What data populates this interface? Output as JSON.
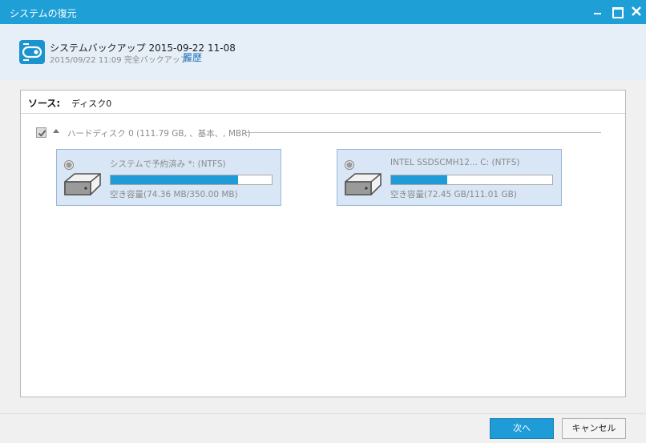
{
  "window": {
    "title": "システムの復元"
  },
  "header": {
    "backup_title": "システムバックアップ 2015-09-22 11-08",
    "backup_subtitle": "2015/09/22 11:09 完全バックアップ",
    "history_link": "履歴"
  },
  "source": {
    "label": "ソース:",
    "value": "ディスク0"
  },
  "disk": {
    "label": "ハードディスク 0 (111.79 GB, 、基本、, MBR)",
    "checked": true
  },
  "partitions": [
    {
      "name": "システムで予約済み *: (NTFS)",
      "free_label": "空き容量(74.36 MB/350.00 MB)",
      "used_fraction": 0.79,
      "selected": false
    },
    {
      "name": "INTEL SSDSCMH12... C: (NTFS)",
      "free_label": "空き容量(72.45 GB/111.01 GB)",
      "used_fraction": 0.35,
      "selected": false
    }
  ],
  "footer": {
    "next_label": "次へ",
    "cancel_label": "キャンセル"
  },
  "colors": {
    "titlebar": "#1ea0d6",
    "accent": "#1f9bd7",
    "header_bg": "#e6eff8",
    "partition_bg": "#d8e6f6"
  },
  "icons": [
    "backup-icon",
    "minimize-icon",
    "maximize-icon",
    "close-icon",
    "checkbox-check-icon",
    "collapse-arrow-icon",
    "radio-icon",
    "hard-drive-icon"
  ]
}
